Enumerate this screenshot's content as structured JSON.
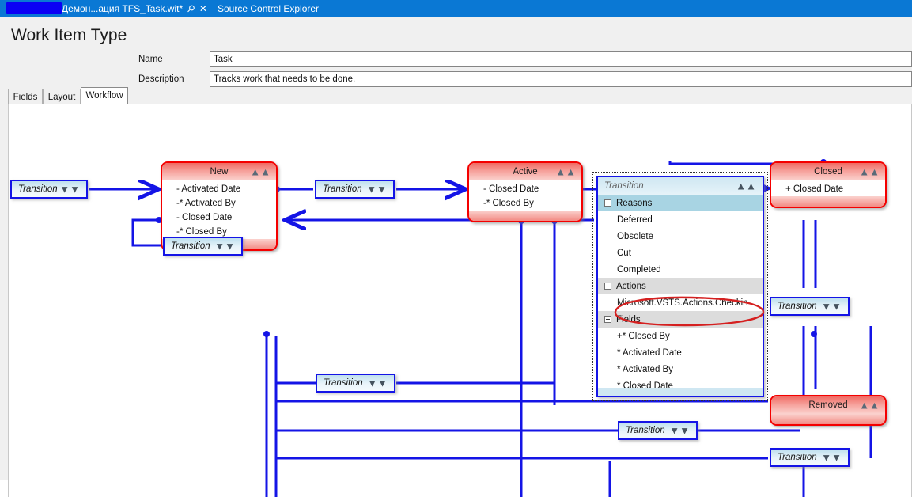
{
  "titlebar": {
    "document_tab": {
      "label": "Демон...ация TFS_Task.wit*",
      "pin_icon": "pin-icon",
      "close_icon": "close-icon",
      "redacted": true
    },
    "other_tab": {
      "label": "Source Control Explorer"
    }
  },
  "designer": {
    "page_title": "Work Item Type",
    "fields": [
      {
        "label": "Name",
        "value": "Task"
      },
      {
        "label": "Description",
        "value": "Tracks work that needs to be done."
      }
    ],
    "tabs": [
      {
        "label": "Fields",
        "selected": false
      },
      {
        "label": "Layout",
        "selected": false
      },
      {
        "label": "Workflow",
        "selected": true
      }
    ]
  },
  "workflow": {
    "states": [
      {
        "name": "New",
        "collapse_icon": "chevron-up-icon",
        "fields": [
          "- Activated Date",
          "-* Activated By",
          "- Closed Date",
          "-* Closed By"
        ]
      },
      {
        "name": "Active",
        "collapse_icon": "chevron-up-icon",
        "fields": [
          "- Closed Date",
          "-* Closed By"
        ]
      },
      {
        "name": "Closed",
        "collapse_icon": "chevron-up-icon",
        "fields": [
          "+ Closed Date"
        ]
      },
      {
        "name": "Removed",
        "collapse_icon": "chevron-up-icon",
        "fields": []
      }
    ],
    "transitions": [
      {
        "label": "Transition",
        "expand_icon": "chevron-down-icon"
      },
      {
        "label": "Transition",
        "expand_icon": "chevron-down-icon"
      },
      {
        "label": "Transition",
        "expand_icon": "chevron-down-icon"
      },
      {
        "label": "Transition",
        "expand_icon": "chevron-down-icon"
      },
      {
        "label": "Transition",
        "expand_icon": "chevron-down-icon"
      },
      {
        "label": "Transition",
        "expand_icon": "chevron-down-icon"
      },
      {
        "label": "Transition",
        "expand_icon": "chevron-down-icon"
      },
      {
        "label": "Transition",
        "expand_icon": "chevron-down-icon"
      }
    ],
    "selected_transition": {
      "title": "Transition",
      "collapse_icon": "chevron-up-icon",
      "groups": [
        {
          "name": "Reasons",
          "style": "blue",
          "toggle_icon": "minus-box-icon",
          "items": [
            "Deferred",
            "Obsolete",
            "Cut",
            "Completed"
          ]
        },
        {
          "name": "Actions",
          "style": "gray",
          "toggle_icon": "minus-box-icon",
          "items": [
            "Microsoft.VSTS.Actions.Checkin"
          ]
        },
        {
          "name": "Fields",
          "style": "gray",
          "toggle_icon": "minus-box-icon",
          "items": [
            "+* Closed By",
            "* Activated Date",
            "* Activated By",
            "* Closed Date"
          ]
        }
      ],
      "annotation": {
        "type": "ellipse",
        "target": "Microsoft.VSTS.Actions.Checkin",
        "color": "#d52020"
      }
    }
  },
  "colors": {
    "titlebar": "#0a78d4",
    "state_border": "#f40000",
    "connector": "#1414e6",
    "panel_highlight": "#a8d4e3",
    "annotation": "#d52020"
  }
}
